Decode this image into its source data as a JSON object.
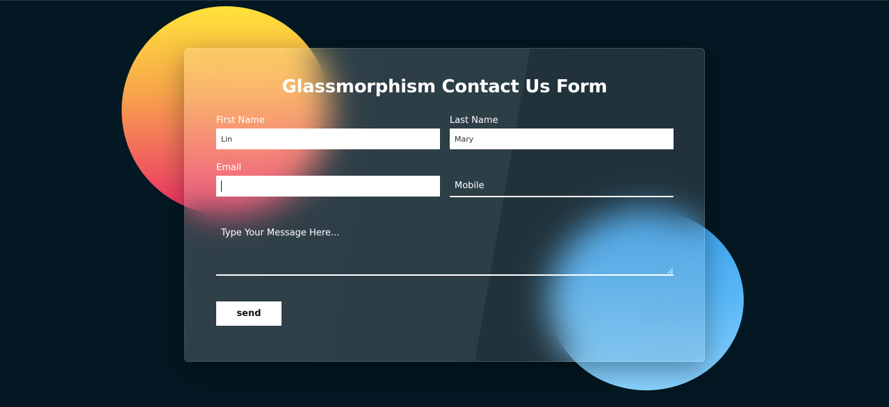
{
  "form": {
    "title": "Glassmorphism Contact Us Form",
    "first_name": {
      "label": "First Name",
      "value": "Lin"
    },
    "last_name": {
      "label": "Last Name",
      "value": "Mary"
    },
    "email": {
      "label": "Email",
      "value": ""
    },
    "mobile": {
      "placeholder": "Mobile"
    },
    "message": {
      "placeholder": "Type Your Message Here..."
    },
    "send_label": "send"
  },
  "colors": {
    "background": "#031822",
    "warm_circle_top": "#ffe23a",
    "warm_circle_bottom": "#ec2e63",
    "cool_circle_top": "#3aa3f0",
    "cool_circle_bottom": "#8ad3ff",
    "field_background": "#ffffff"
  }
}
